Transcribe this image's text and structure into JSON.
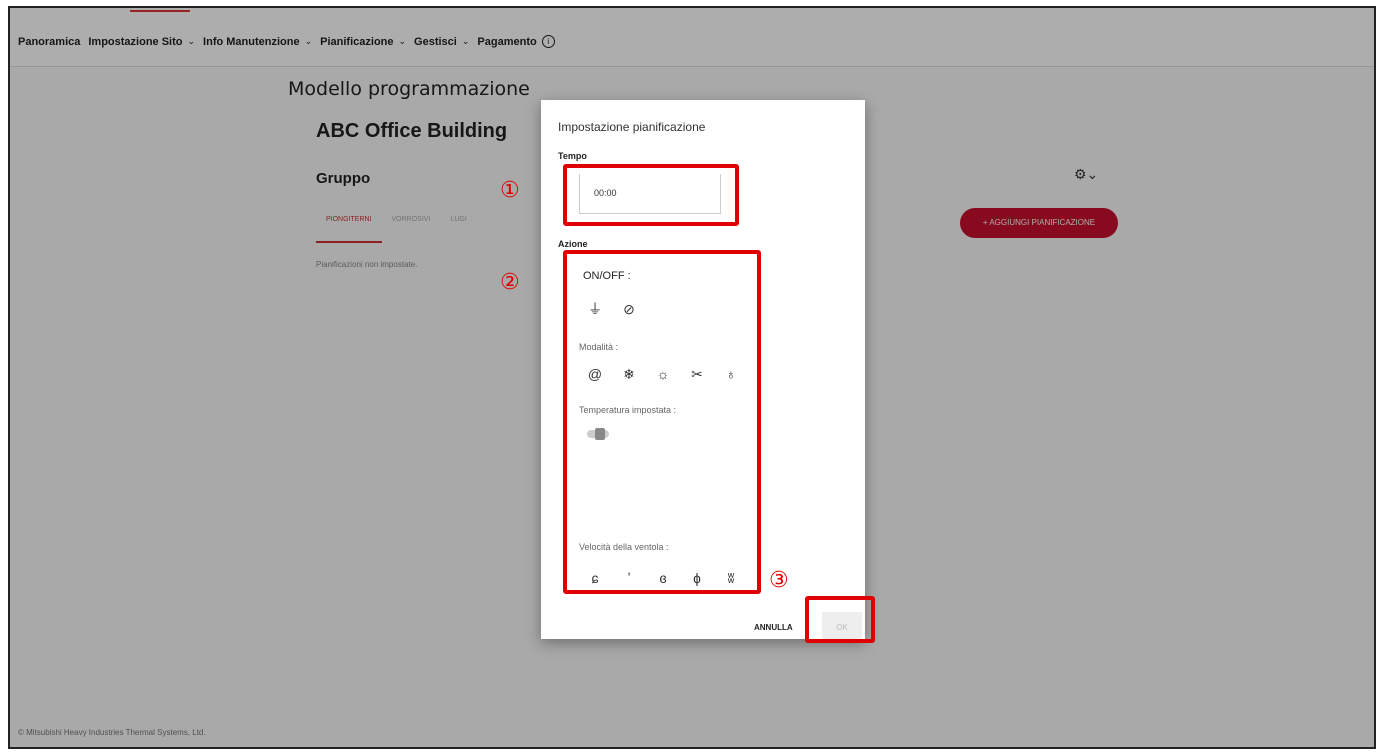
{
  "nav": {
    "items": [
      {
        "label": "Panoramica",
        "has_dropdown": false
      },
      {
        "label": "Impostazione Sito",
        "has_dropdown": true
      },
      {
        "label": "Info Manutenzione",
        "has_dropdown": true
      },
      {
        "label": "Pianificazione",
        "has_dropdown": true
      },
      {
        "label": "Gestisci",
        "has_dropdown": true
      },
      {
        "label": "Pagamento",
        "has_info": true
      }
    ],
    "chevron": "⌄",
    "info_glyph": "i"
  },
  "page": {
    "title": "Modello programmazione",
    "building": "ABC Office Building",
    "group": "Gruppo",
    "tabs": [
      "PIONGITERNI",
      "VORROSIVI",
      "LUGI"
    ],
    "empty_message": "Pianificazioni non impostate.",
    "add_button": "+ AGGIUNGI PIANIFICAZIONE",
    "gear_glyph": "⚙⌄"
  },
  "dialog": {
    "title": "Impostazione pianificazione",
    "time_label": "Tempo",
    "time_value": "00:00",
    "action_label": "Azione",
    "onoff_label": "ON/OFF :",
    "onoff_icons": [
      "ac-on-icon",
      "ac-off-icon"
    ],
    "mode_label": "Modalità :",
    "mode_icons": [
      "auto-mode-icon",
      "cool-mode-icon",
      "heat-mode-icon",
      "fan-mode-icon",
      "dry-mode-icon"
    ],
    "temp_label": "Temperatura impostata :",
    "fan_label": "Velocità della ventola :",
    "fan_icons": [
      "fan-auto-icon",
      "fan-speed-1-icon",
      "fan-speed-2-icon",
      "fan-speed-3-icon",
      "fan-speed-4-icon"
    ],
    "cancel": "ANNULLA",
    "ok": "OK"
  },
  "footer": "© Mitsubishi Heavy Industries Thermal Systems, Ltd.",
  "annotations": [
    "①",
    "②",
    "③"
  ],
  "colors": {
    "accent": "#c8102e",
    "highlight": "#e00000"
  }
}
